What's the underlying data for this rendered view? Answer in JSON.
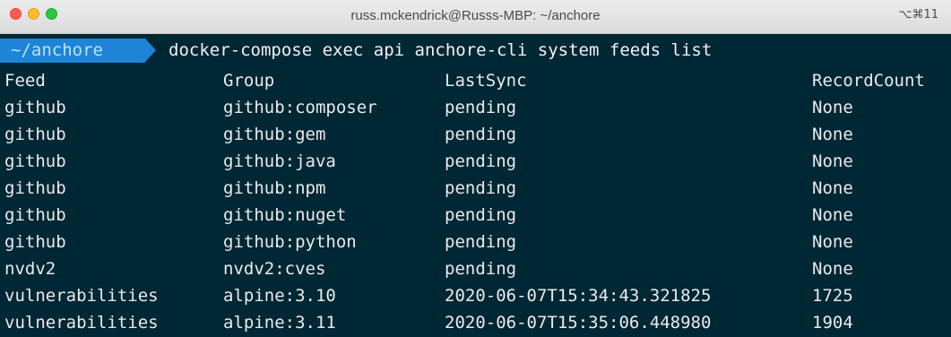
{
  "window": {
    "title": "russ.mckendrick@Russs-MBP: ~/anchore",
    "shortcut": "⌥⌘11"
  },
  "prompt": {
    "directory": "~/anchore",
    "command": "docker-compose exec api anchore-cli system feeds list"
  },
  "table": {
    "headers": {
      "feed": "Feed",
      "group": "Group",
      "last_sync": "LastSync",
      "record_count": "RecordCount"
    },
    "rows": [
      {
        "feed": "github",
        "group": "github:composer",
        "last_sync": "pending",
        "record_count": "None"
      },
      {
        "feed": "github",
        "group": "github:gem",
        "last_sync": "pending",
        "record_count": "None"
      },
      {
        "feed": "github",
        "group": "github:java",
        "last_sync": "pending",
        "record_count": "None"
      },
      {
        "feed": "github",
        "group": "github:npm",
        "last_sync": "pending",
        "record_count": "None"
      },
      {
        "feed": "github",
        "group": "github:nuget",
        "last_sync": "pending",
        "record_count": "None"
      },
      {
        "feed": "github",
        "group": "github:python",
        "last_sync": "pending",
        "record_count": "None"
      },
      {
        "feed": "nvdv2",
        "group": "nvdv2:cves",
        "last_sync": "pending",
        "record_count": "None"
      },
      {
        "feed": "vulnerabilities",
        "group": "alpine:3.10",
        "last_sync": "2020-06-07T15:34:43.321825",
        "record_count": "1725"
      },
      {
        "feed": "vulnerabilities",
        "group": "alpine:3.11",
        "last_sync": "2020-06-07T15:35:06.448980",
        "record_count": "1904"
      }
    ]
  },
  "colors": {
    "terminal_background": "#002734",
    "terminal_text": "#eaeaea",
    "prompt_badge": "#1d84d8",
    "prompt_badge_text": "#bfe1ff"
  }
}
